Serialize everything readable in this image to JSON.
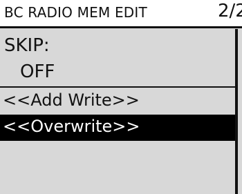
{
  "header": {
    "title": "BC RADIO MEM EDIT",
    "page": "2/2"
  },
  "setting": {
    "label": "SKIP:",
    "value": "OFF"
  },
  "menu": {
    "items": [
      {
        "label": "<<Add Write>>",
        "selected": false
      },
      {
        "label": "<<Overwrite>>",
        "selected": true
      }
    ]
  },
  "colors": {
    "background": "#d8d8d8",
    "text": "#111111",
    "highlight": "#000000",
    "highlight_text": "#ffffff"
  }
}
